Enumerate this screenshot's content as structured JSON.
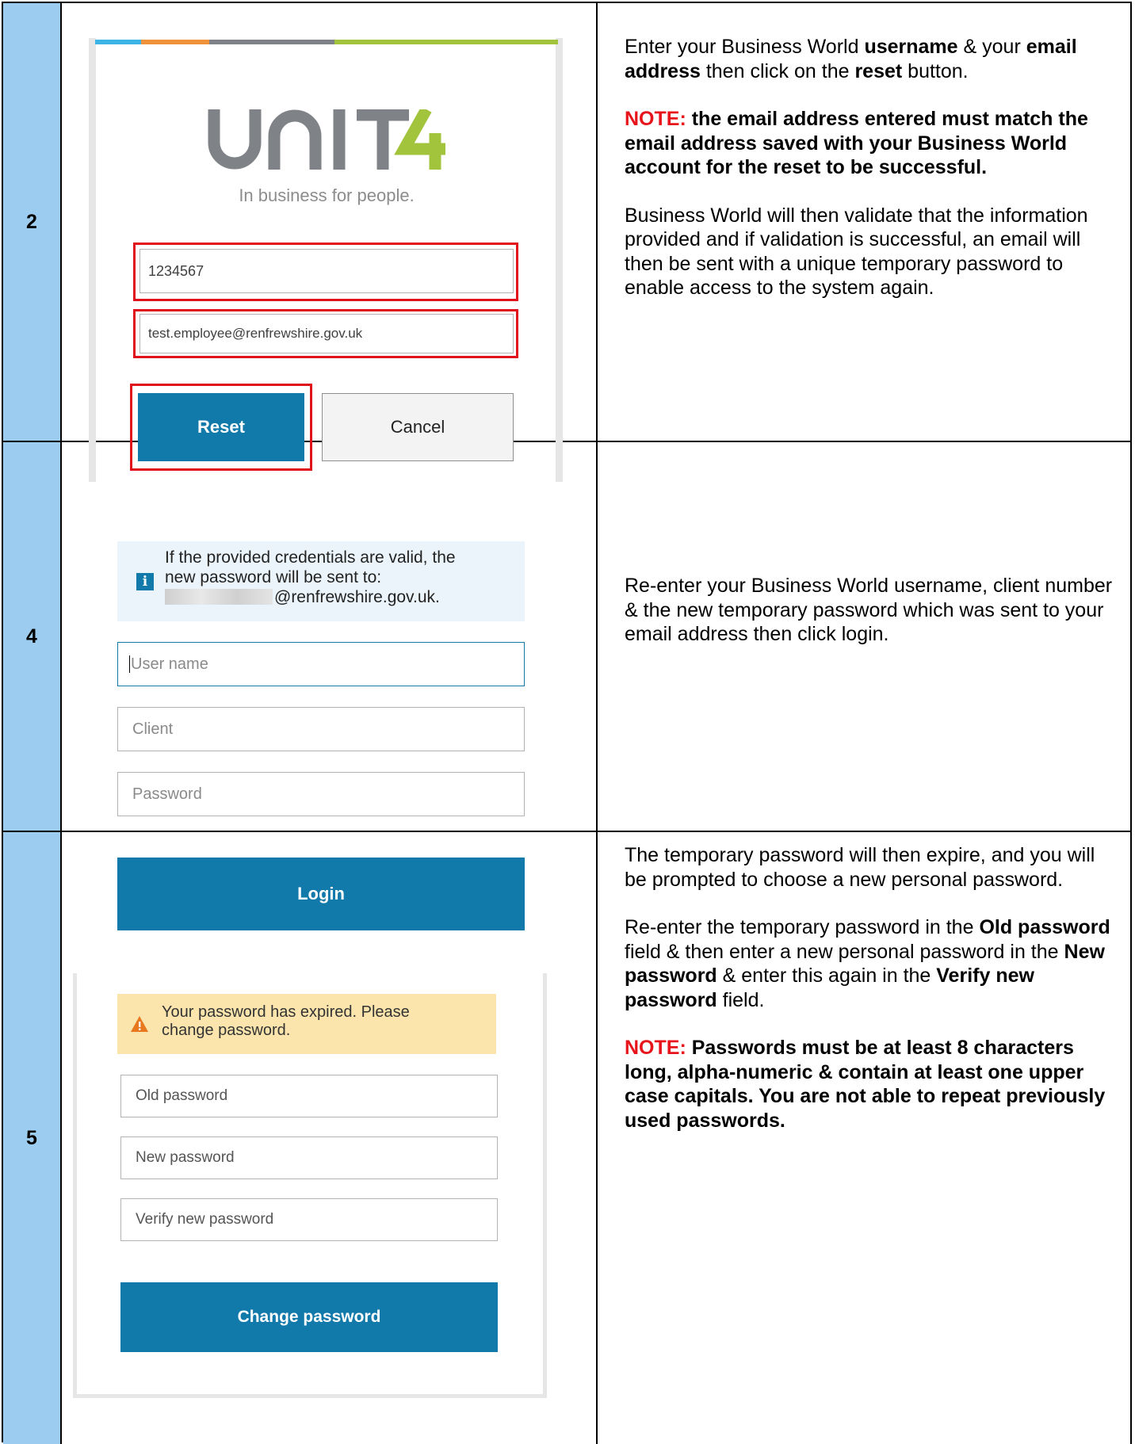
{
  "rows": [
    {
      "step": "2",
      "logo": {
        "text": "UNIT4",
        "tagline": "In business for people.",
        "colors": {
          "grey": "#7f8286",
          "green": "#a2c43d"
        }
      },
      "stripe_colors": [
        "#3cb4e5",
        "#f0913c",
        "#7f8286",
        "#a2c43d"
      ],
      "username_value": "1234567",
      "email_value": "test.employee@renfrewshire.gov.uk",
      "reset_label": "Reset",
      "cancel_label": "Cancel",
      "text": {
        "p1": [
          "Enter your Business World ",
          "username",
          " & your ",
          "email address",
          " then click on the ",
          "reset",
          " button."
        ],
        "note_label": "NOTE:",
        "note_text": " the email address entered must match the email address saved with your Business World account for the reset to be successful.",
        "p3": "Business World will then validate that the information provided and if validation is successful, an email will then be sent with a unique temporary password to enable access to the system again."
      }
    },
    {
      "step": "4",
      "info_text": [
        "If the provided credentials are valid, the",
        "new password will be sent to:",
        "@renfrewshire.gov.uk."
      ],
      "info_icon": "info-icon",
      "username_placeholder": "User name",
      "client_placeholder": "Client",
      "password_placeholder": "Password",
      "login_label": "Login",
      "text": "Re-enter your Business World username, client number & the new temporary password which was sent to your email address then click login."
    },
    {
      "step": "5",
      "warning_icon": "warning-icon",
      "warning_text": [
        "Your password has expired. Please",
        "change password."
      ],
      "old_placeholder": "Old password",
      "new_placeholder": "New password",
      "verify_placeholder": "Verify new password",
      "change_label": "Change password",
      "text": {
        "p1": "The temporary password will then expire, and you will be prompted to choose a new personal password.",
        "p2": [
          "Re-enter the temporary password in the ",
          "Old password",
          " field & then enter a new personal password in the ",
          "New password",
          " & enter this again in the ",
          "Verify new password",
          " field."
        ],
        "note_label": "NOTE:",
        "note_text": " Passwords must be at least 8 characters long, alpha-numeric & contain at least one upper case capitals. You are not able to repeat previously used passwords."
      }
    }
  ]
}
